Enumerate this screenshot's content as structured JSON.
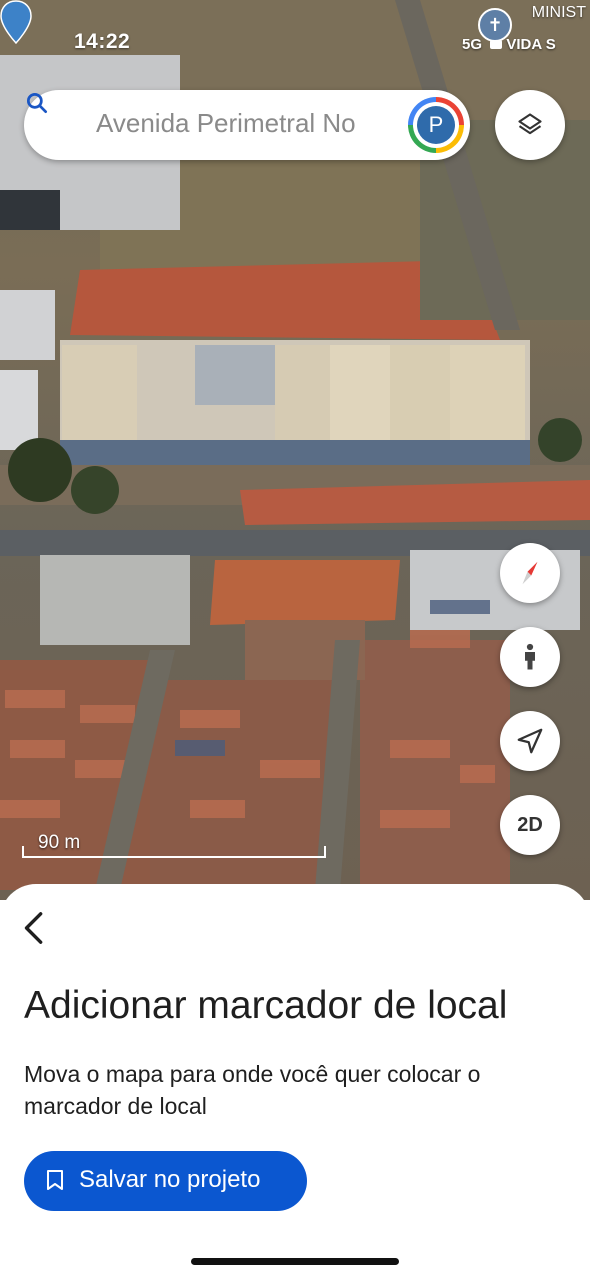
{
  "status_bar": {
    "time": "14:22",
    "network": "5G",
    "place_label_line1": "MINIST",
    "place_label_line2": "VIDA S"
  },
  "search": {
    "text": "Avenida Perimetral No",
    "avatar_letter": "P"
  },
  "map": {
    "scale_label": "90 m",
    "controls": {
      "compass": "compass-icon",
      "street_view": "pegman-icon",
      "my_location": "navigation-arrow-icon",
      "view_mode_label": "2D"
    }
  },
  "sheet": {
    "title": "Adicionar marcador de local",
    "description": "Mova o mapa para onde você quer colocar o marcador de local",
    "save_button_label": "Salvar no projeto"
  },
  "colors": {
    "primary_button": "#0b57d0",
    "location_pin": "#3d82c8",
    "compass_red": "#e53935"
  }
}
